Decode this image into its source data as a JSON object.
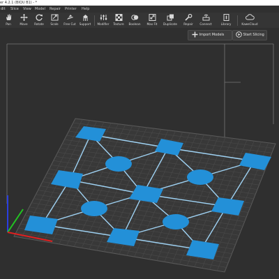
{
  "window": {
    "title": "er 4.2.1 (BIQU B1) - *"
  },
  "menu": [
    "dit",
    "Slice",
    "View",
    "Model",
    "Repair",
    "Printer",
    "Help"
  ],
  "toolbar": {
    "items": [
      {
        "label": "Pan",
        "icon": "hand-icon"
      },
      {
        "label": "Move",
        "icon": "move-icon"
      },
      {
        "label": "Rotate",
        "icon": "rotate-icon"
      },
      {
        "label": "Scale",
        "icon": "scale-icon"
      },
      {
        "label": "Free Cut",
        "icon": "cut-icon"
      },
      {
        "label": "Support",
        "icon": "support-icon"
      },
      {
        "label": "Modifier",
        "icon": "modifier-icon"
      },
      {
        "label": "Texture",
        "icon": "texture-icon"
      },
      {
        "label": "Boolean",
        "icon": "boolean-icon"
      },
      {
        "label": "Max Fit",
        "icon": "max-fit-icon"
      },
      {
        "label": "Duplicate",
        "icon": "duplicate-icon"
      },
      {
        "label": "Repair",
        "icon": "repair-icon"
      },
      {
        "label": "Connect",
        "icon": "connect-icon"
      },
      {
        "label": "Library",
        "icon": "library-icon"
      },
      {
        "label": "KaweCloud",
        "icon": "cloud-icon"
      }
    ]
  },
  "viewport": {
    "import_label": "Import Models",
    "slice_label": "Start Slicing",
    "colors": {
      "model": "#2390d8",
      "grid_line": "#4a4a4a",
      "background": "#2f2f2f",
      "axis_x": "#e02020",
      "axis_y": "#22c422",
      "axis_z": "#2a3fe0"
    }
  }
}
